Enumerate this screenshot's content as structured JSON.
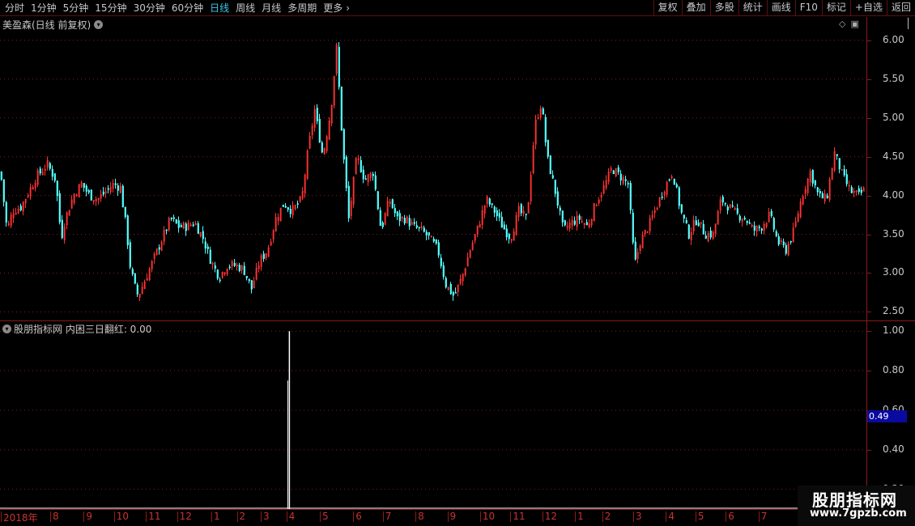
{
  "toolbar": {
    "periods": [
      {
        "label": "分时"
      },
      {
        "label": "1分钟"
      },
      {
        "label": "5分钟"
      },
      {
        "label": "15分钟"
      },
      {
        "label": "30分钟"
      },
      {
        "label": "60分钟"
      },
      {
        "label": "日线"
      },
      {
        "label": "周线"
      },
      {
        "label": "月线"
      },
      {
        "label": "多周期"
      },
      {
        "label": "更多"
      }
    ],
    "active_period": "日线",
    "functions": [
      {
        "label": "复权"
      },
      {
        "label": "叠加"
      },
      {
        "label": "多股"
      },
      {
        "label": "统计"
      },
      {
        "label": "画线"
      },
      {
        "label": "F10"
      },
      {
        "label": "标记"
      },
      {
        "label": "+自选"
      },
      {
        "label": "返回"
      }
    ]
  },
  "main_panel": {
    "title": "美盈森(日线 前复权)"
  },
  "indicator_panel": {
    "title": "股朋指标网 内困三日翻红: 0.00",
    "current_value": "0.49"
  },
  "chart_data": [
    {
      "type": "candlestick",
      "ylim": [
        2.4,
        6.3
      ],
      "y_ticks": [
        "6.00",
        "5.50",
        "5.00",
        "4.50",
        "4.00",
        "3.50",
        "3.00",
        "2.50"
      ],
      "up_color": "#ff3232",
      "down_color": "#54ffff",
      "close_path": [
        [
          0,
          4.3
        ],
        [
          8,
          3.55
        ],
        [
          15,
          3.8
        ],
        [
          25,
          3.85
        ],
        [
          35,
          4.05
        ],
        [
          45,
          4.25
        ],
        [
          58,
          4.4
        ],
        [
          68,
          4.2
        ],
        [
          75,
          3.45
        ],
        [
          80,
          3.7
        ],
        [
          90,
          4.0
        ],
        [
          100,
          4.15
        ],
        [
          110,
          4.0
        ],
        [
          120,
          3.95
        ],
        [
          130,
          4.05
        ],
        [
          140,
          4.15
        ],
        [
          148,
          4.1
        ],
        [
          155,
          3.6
        ],
        [
          160,
          3.1
        ],
        [
          165,
          2.85
        ],
        [
          170,
          2.7
        ],
        [
          180,
          2.95
        ],
        [
          190,
          3.2
        ],
        [
          200,
          3.45
        ],
        [
          210,
          3.7
        ],
        [
          220,
          3.6
        ],
        [
          230,
          3.6
        ],
        [
          240,
          3.65
        ],
        [
          250,
          3.45
        ],
        [
          260,
          3.15
        ],
        [
          270,
          2.95
        ],
        [
          280,
          3.1
        ],
        [
          290,
          3.1
        ],
        [
          300,
          3.05
        ],
        [
          310,
          2.8
        ],
        [
          320,
          3.15
        ],
        [
          330,
          3.3
        ],
        [
          340,
          3.7
        ],
        [
          350,
          3.9
        ],
        [
          360,
          3.8
        ],
        [
          372,
          3.95
        ],
        [
          380,
          4.6
        ],
        [
          388,
          5.1
        ],
        [
          398,
          4.5
        ],
        [
          408,
          5.1
        ],
        [
          415,
          5.9
        ],
        [
          422,
          4.7
        ],
        [
          430,
          3.7
        ],
        [
          440,
          4.5
        ],
        [
          450,
          4.2
        ],
        [
          460,
          4.3
        ],
        [
          470,
          3.55
        ],
        [
          480,
          3.95
        ],
        [
          490,
          3.7
        ],
        [
          500,
          3.7
        ],
        [
          510,
          3.6
        ],
        [
          520,
          3.55
        ],
        [
          530,
          3.45
        ],
        [
          540,
          3.3
        ],
        [
          550,
          2.85
        ],
        [
          560,
          2.7
        ],
        [
          570,
          2.95
        ],
        [
          580,
          3.3
        ],
        [
          590,
          3.6
        ],
        [
          600,
          3.95
        ],
        [
          610,
          3.8
        ],
        [
          620,
          3.6
        ],
        [
          630,
          3.45
        ],
        [
          640,
          3.8
        ],
        [
          650,
          3.7
        ],
        [
          660,
          4.9
        ],
        [
          668,
          5.2
        ],
        [
          675,
          4.5
        ],
        [
          685,
          4.05
        ],
        [
          695,
          3.55
        ],
        [
          705,
          3.65
        ],
        [
          715,
          3.7
        ],
        [
          725,
          3.6
        ],
        [
          735,
          3.9
        ],
        [
          745,
          4.1
        ],
        [
          755,
          4.35
        ],
        [
          765,
          4.25
        ],
        [
          775,
          4.15
        ],
        [
          783,
          3.1
        ],
        [
          790,
          3.4
        ],
        [
          800,
          3.6
        ],
        [
          810,
          3.85
        ],
        [
          820,
          4.1
        ],
        [
          830,
          4.3
        ],
        [
          840,
          3.8
        ],
        [
          850,
          3.5
        ],
        [
          860,
          3.7
        ],
        [
          870,
          3.5
        ],
        [
          880,
          3.5
        ],
        [
          890,
          3.95
        ],
        [
          900,
          3.85
        ],
        [
          910,
          3.75
        ],
        [
          920,
          3.7
        ],
        [
          930,
          3.55
        ],
        [
          940,
          3.6
        ],
        [
          950,
          3.75
        ],
        [
          960,
          3.4
        ],
        [
          970,
          3.3
        ],
        [
          980,
          3.55
        ],
        [
          990,
          4.0
        ],
        [
          1000,
          4.3
        ],
        [
          1010,
          4.0
        ],
        [
          1020,
          3.95
        ],
        [
          1030,
          4.55
        ],
        [
          1040,
          4.25
        ],
        [
          1050,
          4.05
        ],
        [
          1060,
          4.0
        ],
        [
          1069,
          4.1
        ]
      ]
    },
    {
      "type": "bar",
      "ylim": [
        0.1,
        1.05
      ],
      "y_ticks": [
        "1.00",
        "0.80",
        "0.60",
        "0.40",
        "0.20"
      ],
      "spike_position": 0.334,
      "spike_value": 1.0
    }
  ],
  "date_axis": {
    "labels": [
      {
        "label": "2018年",
        "pos": 0.004
      },
      {
        "label": "8",
        "pos": 0.066
      },
      {
        "label": "9",
        "pos": 0.108
      },
      {
        "label": "10",
        "pos": 0.146
      },
      {
        "label": "11",
        "pos": 0.186
      },
      {
        "label": "12",
        "pos": 0.225
      },
      {
        "label": "1",
        "pos": 0.268
      },
      {
        "label": "2",
        "pos": 0.3
      },
      {
        "label": "3",
        "pos": 0.33
      },
      {
        "label": "4",
        "pos": 0.362
      },
      {
        "label": "5",
        "pos": 0.404
      },
      {
        "label": "6",
        "pos": 0.446
      },
      {
        "label": "7",
        "pos": 0.483
      },
      {
        "label": "8",
        "pos": 0.524
      },
      {
        "label": "9",
        "pos": 0.564
      },
      {
        "label": "10",
        "pos": 0.605
      },
      {
        "label": "11",
        "pos": 0.643
      },
      {
        "label": "12",
        "pos": 0.683
      },
      {
        "label": "1",
        "pos": 0.724
      },
      {
        "label": "2",
        "pos": 0.758
      },
      {
        "label": "3",
        "pos": 0.797
      },
      {
        "label": "4",
        "pos": 0.838
      },
      {
        "label": "5",
        "pos": 0.875
      },
      {
        "label": "6",
        "pos": 0.913
      },
      {
        "label": "7",
        "pos": 0.954
      }
    ]
  },
  "watermark": {
    "title": "股朋指标网",
    "url": "www.7gpzb.com"
  }
}
